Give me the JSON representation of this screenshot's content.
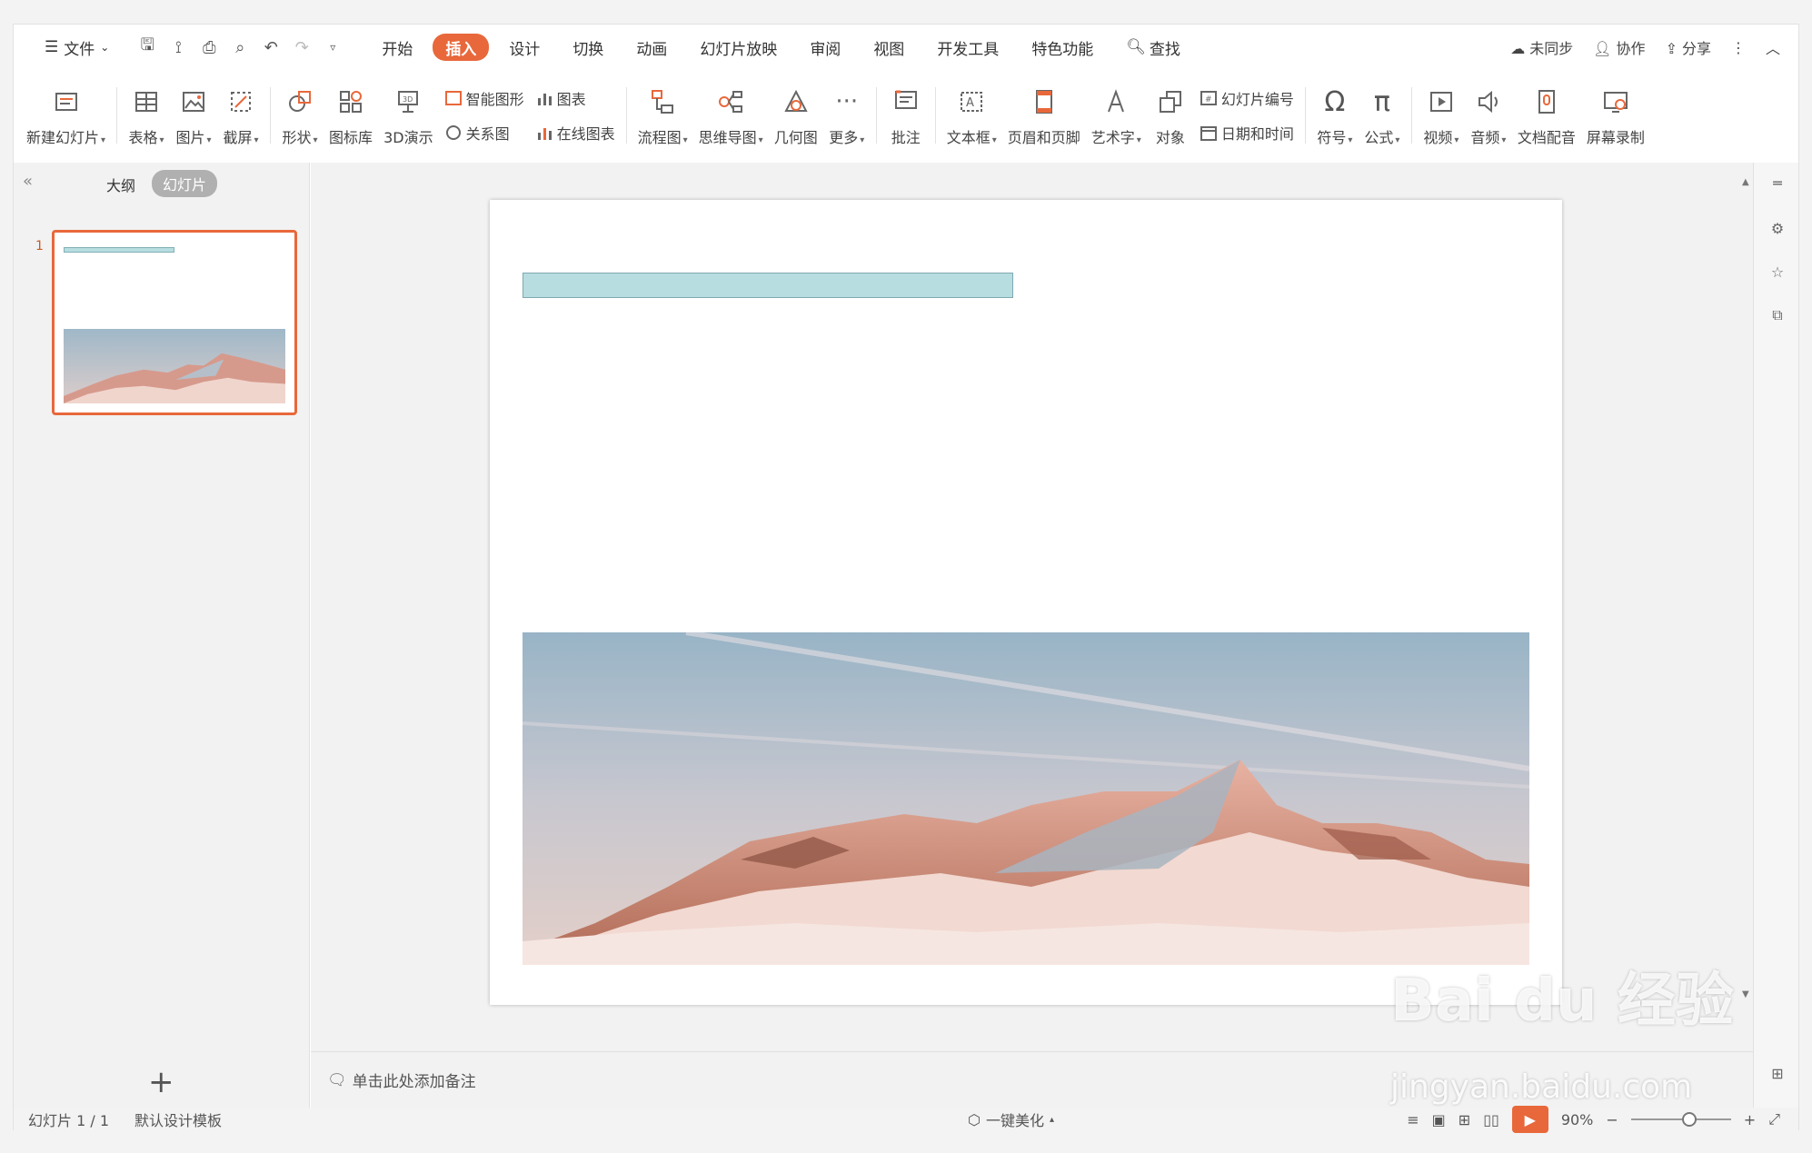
{
  "menubar": {
    "file_label": "文件",
    "tabs": [
      "开始",
      "插入",
      "设计",
      "切换",
      "动画",
      "幻灯片放映",
      "审阅",
      "视图",
      "开发工具",
      "特色功能"
    ],
    "active_tab": "插入",
    "search_label": "查找",
    "sync_label": "未同步",
    "collab_label": "协作",
    "share_label": "分享"
  },
  "ribbon": {
    "new_slide": "新建幻灯片",
    "table": "表格",
    "picture": "图片",
    "screenshot": "截屏",
    "shape": "形状",
    "icon_lib": "图标库",
    "demo3d": "3D演示",
    "smart_graphic": "智能图形",
    "chart": "图表",
    "relation": "关系图",
    "online_chart": "在线图表",
    "flowchart": "流程图",
    "mindmap": "思维导图",
    "geometry": "几何图",
    "more": "更多",
    "comment": "批注",
    "textbox": "文本框",
    "header_footer": "页眉和页脚",
    "wordart": "艺术字",
    "object": "对象",
    "slide_number": "幻灯片编号",
    "datetime": "日期和时间",
    "symbol": "符号",
    "formula": "公式",
    "video": "视频",
    "audio": "音频",
    "dub": "文档配音",
    "screen_record": "屏幕录制"
  },
  "leftpanel": {
    "tab_outline": "大纲",
    "tab_slides": "幻灯片",
    "slide_number": "1"
  },
  "notes": {
    "placeholder": "单击此处添加备注"
  },
  "statusbar": {
    "slide_info": "幻灯片 1 / 1",
    "template": "默认设计模板",
    "beautify": "一键美化",
    "zoom": "90%"
  },
  "watermark": {
    "brand": "Bai du 经验",
    "url": "jingyan.baidu.com"
  },
  "colors": {
    "accent": "#e8683b",
    "title_bar_fill": "#b8dde0"
  }
}
